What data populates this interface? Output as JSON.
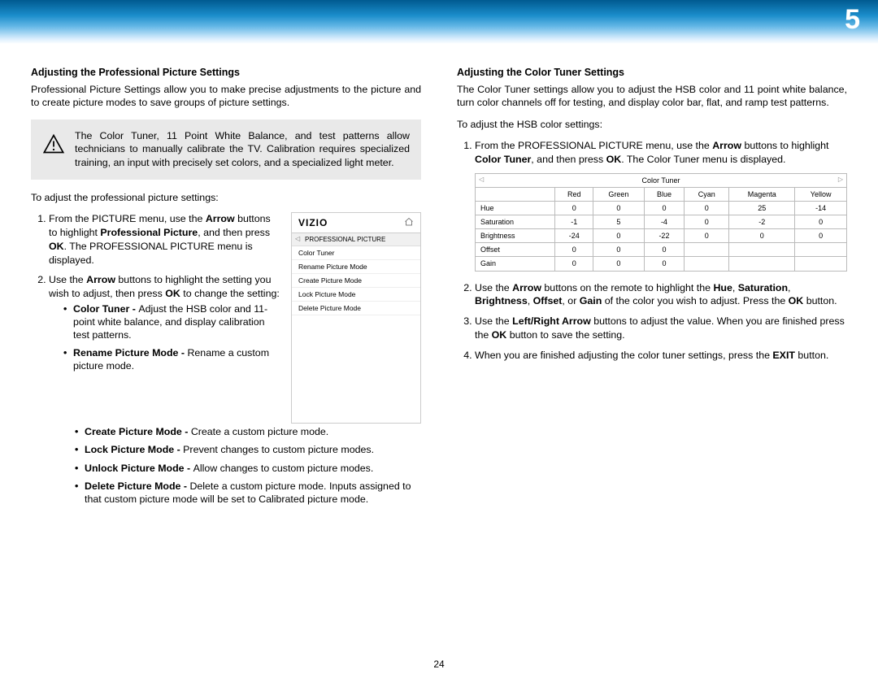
{
  "header": {
    "chapter_number": "5"
  },
  "footer": {
    "page_number": "24"
  },
  "left": {
    "heading": "Adjusting the Professional Picture Settings",
    "intro": "Professional Picture Settings allow you to make precise adjustments to the picture and to create picture modes to save groups of picture settings.",
    "callout": "The Color Tuner, 11 Point White Balance, and test patterns allow technicians to manually calibrate the TV. Calibration requires specialized training, an input with precisely set colors, and a specialized light meter.",
    "lead2": "To adjust the professional picture settings:",
    "step1_a": "From the PICTURE menu, use the ",
    "step1_b": "Arrow",
    "step1_c": " buttons to highlight ",
    "step1_d": "Professional Picture",
    "step1_e": ", and then press ",
    "step1_f": "OK",
    "step1_g": ". The PROFESSIONAL PICTURE menu is displayed.",
    "step2_a": "Use the ",
    "step2_b": "Arrow",
    "step2_c": " buttons to highlight the setting you wish to adjust, then press ",
    "step2_d": "OK",
    "step2_e": " to change the setting:",
    "bul1_a": "Color Tuner - ",
    "bul1_b": "Adjust the HSB color and 11-point white balance, and display calibration test patterns.",
    "bul2_a": "Rename Picture Mode - ",
    "bul2_b": "Rename a custom picture mode.",
    "bul3_a": "Create Picture Mode - ",
    "bul3_b": "Create a custom picture mode.",
    "bul4_a": "Lock Picture Mode - ",
    "bul4_b": "Prevent changes to custom picture modes.",
    "bul5_a": "Unlock Picture Mode - ",
    "bul5_b": "Allow changes to custom picture modes.",
    "bul6_a": "Delete Picture Mode - ",
    "bul6_b": "Delete a custom picture mode. Inputs assigned to that custom picture mode will be set to Calibrated picture mode.",
    "menu": {
      "brand": "VIZIO",
      "title": "PROFESSIONAL PICTURE",
      "items": [
        "Color Tuner",
        "Rename Picture Mode",
        "Create Picture Mode",
        "Lock Picture Mode",
        "Delete Picture Mode"
      ]
    }
  },
  "right": {
    "heading": "Adjusting the Color Tuner Settings",
    "intro": "The Color Tuner settings allow you to adjust the HSB color and 11 point white balance, turn color channels off for testing, and display color bar, flat, and ramp test patterns.",
    "lead2": "To adjust the HSB color settings:",
    "step1_a": "From the PROFESSIONAL PICTURE menu, use the ",
    "step1_b": "Arrow",
    "step1_c": " buttons to highlight ",
    "step1_d": "Color Tuner",
    "step1_e": ", and then press ",
    "step1_f": "OK",
    "step1_g": ". The Color Tuner menu is displayed.",
    "table": {
      "title": "Color Tuner",
      "cols": [
        "Red",
        "Green",
        "Blue",
        "Cyan",
        "Magenta",
        "Yellow"
      ],
      "rows": [
        {
          "label": "Hue",
          "v": [
            "0",
            "0",
            "0",
            "0",
            "25",
            "-14"
          ]
        },
        {
          "label": "Saturation",
          "v": [
            "-1",
            "5",
            "-4",
            "0",
            "-2",
            "0"
          ]
        },
        {
          "label": "Brightness",
          "v": [
            "-24",
            "0",
            "-22",
            "0",
            "0",
            "0"
          ]
        },
        {
          "label": "Offset",
          "v": [
            "0",
            "0",
            "0",
            "",
            "",
            ""
          ]
        },
        {
          "label": "Gain",
          "v": [
            "0",
            "0",
            "0",
            "",
            "",
            ""
          ]
        }
      ]
    },
    "step2_a": "Use the ",
    "step2_b": "Arrow",
    "step2_c": " buttons on the remote to highlight the ",
    "step2_d": "Hue",
    "step2_e": ", ",
    "step2_f": "Saturation",
    "step2_g": ", ",
    "step2_h": "Brightness",
    "step2_i": ", ",
    "step2_j": "Offset",
    "step2_k": ", or ",
    "step2_l": "Gain",
    "step2_m": " of the color you wish to adjust. Press the ",
    "step2_n": "OK",
    "step2_o": "  button.",
    "step3_a": "Use the ",
    "step3_b": "Left/Right Arrow",
    "step3_c": " buttons to adjust the value. When you are finished press the ",
    "step3_d": "OK",
    "step3_e": " button to save the setting.",
    "step4_a": "When you are finished adjusting the color tuner settings, press the ",
    "step4_b": "EXIT",
    "step4_c": " button."
  }
}
